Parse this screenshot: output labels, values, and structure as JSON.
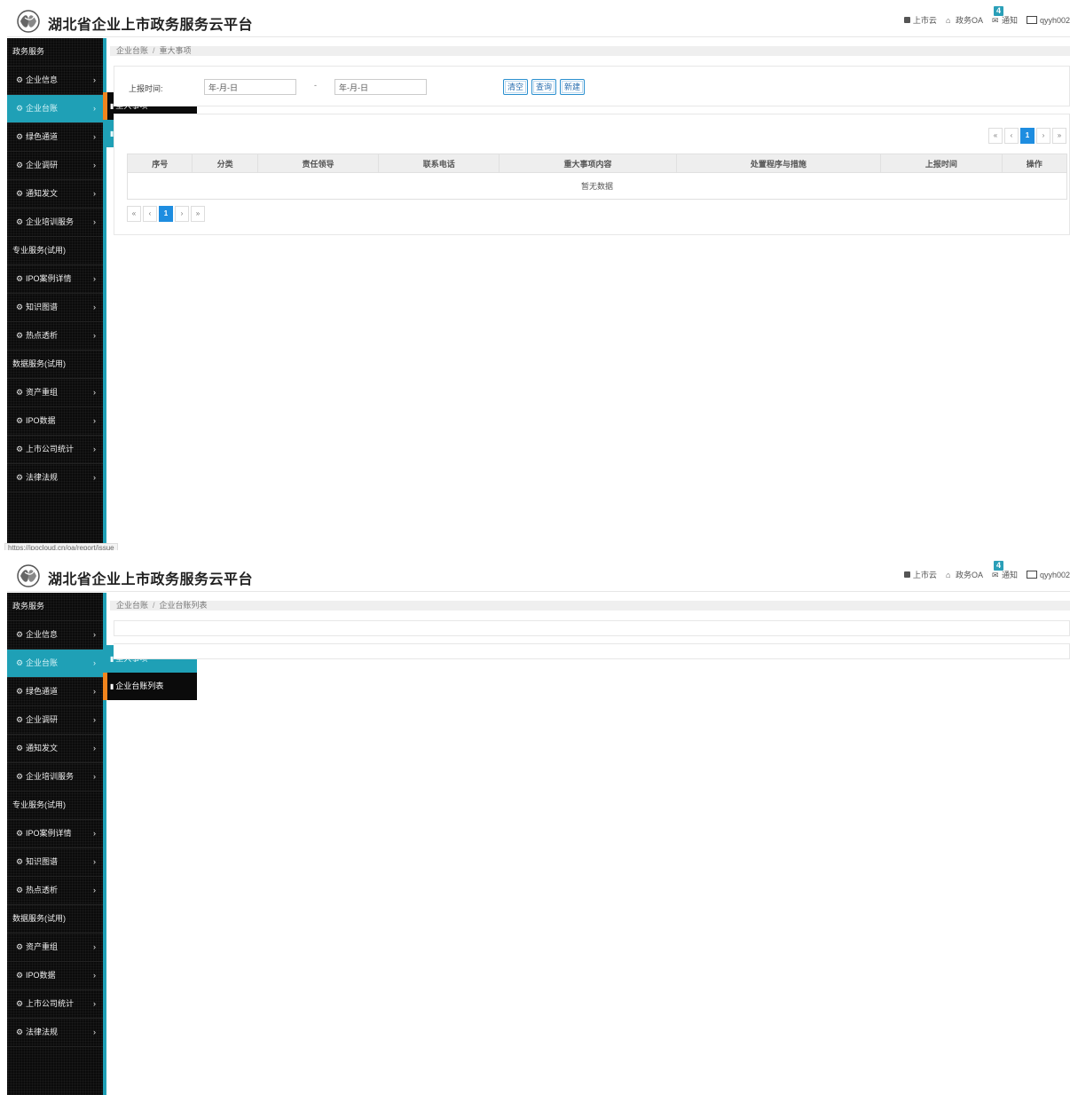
{
  "app": {
    "brand": "湖北省企业上市政务服务云平台"
  },
  "topnav": [
    {
      "icon": "square-icon",
      "label": "上市云"
    },
    {
      "icon": "home-icon",
      "label": "政务OA"
    },
    {
      "icon": "bell-icon",
      "label": "通知",
      "badge": "4"
    },
    {
      "icon": "id-card-icon",
      "label": "qyyh002"
    }
  ],
  "sidebar": {
    "sections": [
      {
        "title": "政务服务",
        "items": [
          "企业信息",
          "企业台账",
          "绿色通道",
          "企业调研",
          "通知发文",
          "企业培训服务"
        ]
      },
      {
        "title": "专业服务(试用)",
        "items": [
          "IPO案例详情",
          "知识图谱",
          "热点透析"
        ]
      },
      {
        "title": "数据服务(试用)",
        "items": [
          "资产重组",
          "IPO数据",
          "上市公司统计",
          "法律法规"
        ]
      }
    ],
    "active_item": "企业台账",
    "chevron": "›"
  },
  "flyout": {
    "items": [
      "重大事项",
      "企业台账列表"
    ]
  },
  "screen1": {
    "breadcrumb": [
      "企业台账",
      "重大事项"
    ],
    "filter": {
      "label": "上报时间:",
      "date_from_placeholder": "年-月-日",
      "separator": "-",
      "date_to_placeholder": "年-月-日",
      "buttons": [
        "清空",
        "查询",
        "新建"
      ]
    },
    "table": {
      "columns": [
        "序号",
        "分类",
        "责任领导",
        "联系电话",
        "重大事项内容",
        "处置程序与措施",
        "上报时间",
        "操作"
      ],
      "empty_text": "暂无数据"
    },
    "pager": [
      "«",
      "‹",
      "1",
      "›",
      "»"
    ],
    "status_url": "https://ipocloud.cn/oa/report/issue"
  },
  "screen2": {
    "breadcrumb": [
      "企业台账",
      "企业台账列表"
    ]
  },
  "colors": {
    "accent": "#1fa0b6",
    "orange": "#f0841d",
    "sidebar_bg": "#0b0b0b",
    "pager_active": "#1e8de0"
  }
}
